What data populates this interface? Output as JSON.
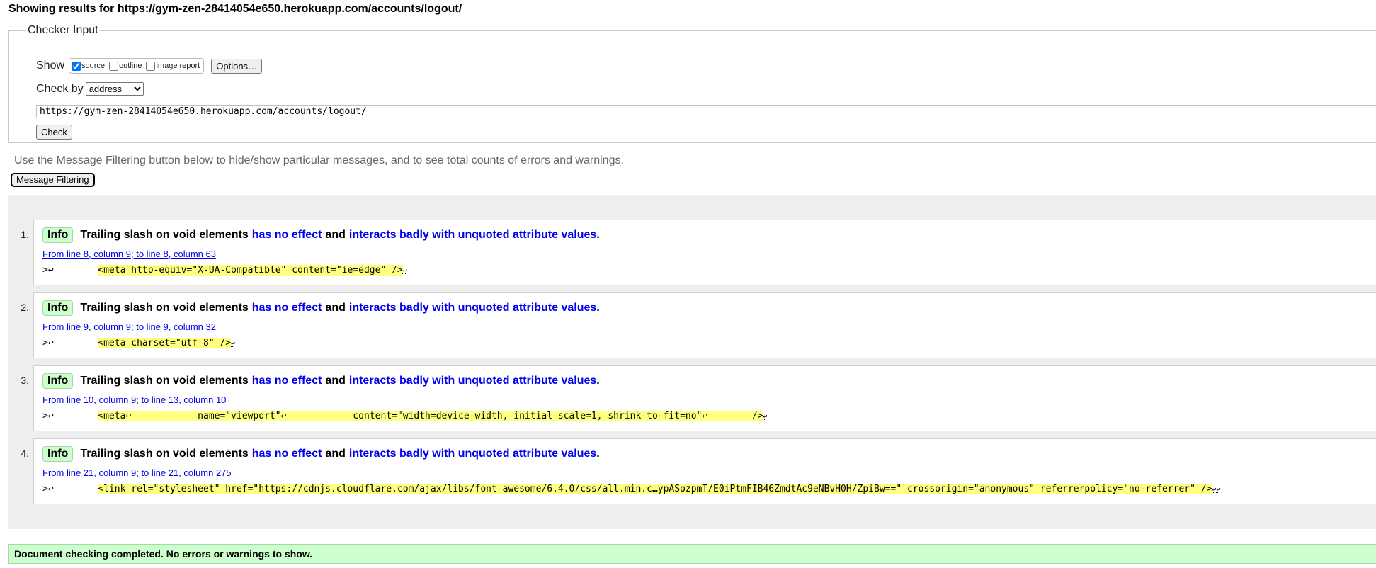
{
  "heading": "Showing results for https://gym-zen-28414054e650.herokuapp.com/accounts/logout/",
  "checker": {
    "legend": "Checker Input",
    "show_label": "Show",
    "show_options": [
      {
        "label": "source",
        "checked": true
      },
      {
        "label": "outline",
        "checked": false
      },
      {
        "label": "image report",
        "checked": false
      }
    ],
    "options_button": "Options…",
    "checkby_label": "Check by",
    "checkby_value": "address",
    "url_value": "https://gym-zen-28414054e650.herokuapp.com/accounts/logout/",
    "check_button": "Check"
  },
  "hint": "Use the Message Filtering button below to hide/show particular messages, and to see total counts of errors and warnings.",
  "filter_button": "Message Filtering",
  "messages": [
    {
      "num": "1.",
      "badge": "Info",
      "text_before": "Trailing slash on void elements",
      "link1": "has no effect",
      "mid": "and",
      "link2": "interacts badly with unquoted attribute values",
      "end": ".",
      "location": "From line 8, column 9; to line 8, column 63",
      "code_prefix": ">↩        ",
      "code_hl": "<meta http-equiv=\"X-UA-Compatible\" content=\"ie=edge\" />",
      "code_suffix": "↩"
    },
    {
      "num": "2.",
      "badge": "Info",
      "text_before": "Trailing slash on void elements",
      "link1": "has no effect",
      "mid": "and",
      "link2": "interacts badly with unquoted attribute values",
      "end": ".",
      "location": "From line 9, column 9; to line 9, column 32",
      "code_prefix": ">↩        ",
      "code_hl": "<meta charset=\"utf-8\" />",
      "code_suffix": "↩"
    },
    {
      "num": "3.",
      "badge": "Info",
      "text_before": "Trailing slash on void elements",
      "link1": "has no effect",
      "mid": "and",
      "link2": "interacts badly with unquoted attribute values",
      "end": ".",
      "location": "From line 10, column 9; to line 13, column 10",
      "code_prefix": ">↩        ",
      "code_hl": "<meta↩            name=\"viewport\"↩            content=\"width=device-width, initial-scale=1, shrink-to-fit=no\"↩        />",
      "code_suffix": "↩"
    },
    {
      "num": "4.",
      "badge": "Info",
      "text_before": "Trailing slash on void elements",
      "link1": "has no effect",
      "mid": "and",
      "link2": "interacts badly with unquoted attribute values",
      "end": ".",
      "location": "From line 21, column 9; to line 21, column 275",
      "code_prefix": ">↩        ",
      "code_hl": "<link rel=\"stylesheet\" href=\"https://cdnjs.cloudflare.com/ajax/libs/font-awesome/6.4.0/css/all.min.c…ypASozpmT/E0iPtmFIB46ZmdtAc9eNBvH0H/ZpiBw==\" crossorigin=\"anonymous\" referrerpolicy=\"no-referrer\" />",
      "code_suffix": "↩↩"
    }
  ],
  "done_text": "Document checking completed. No errors or warnings to show.",
  "colors": {
    "info_badge_bg": "#ccffcc",
    "code_highlight": "#ffff80",
    "link": "#0000ee",
    "results_bg": "#eeeeee"
  }
}
